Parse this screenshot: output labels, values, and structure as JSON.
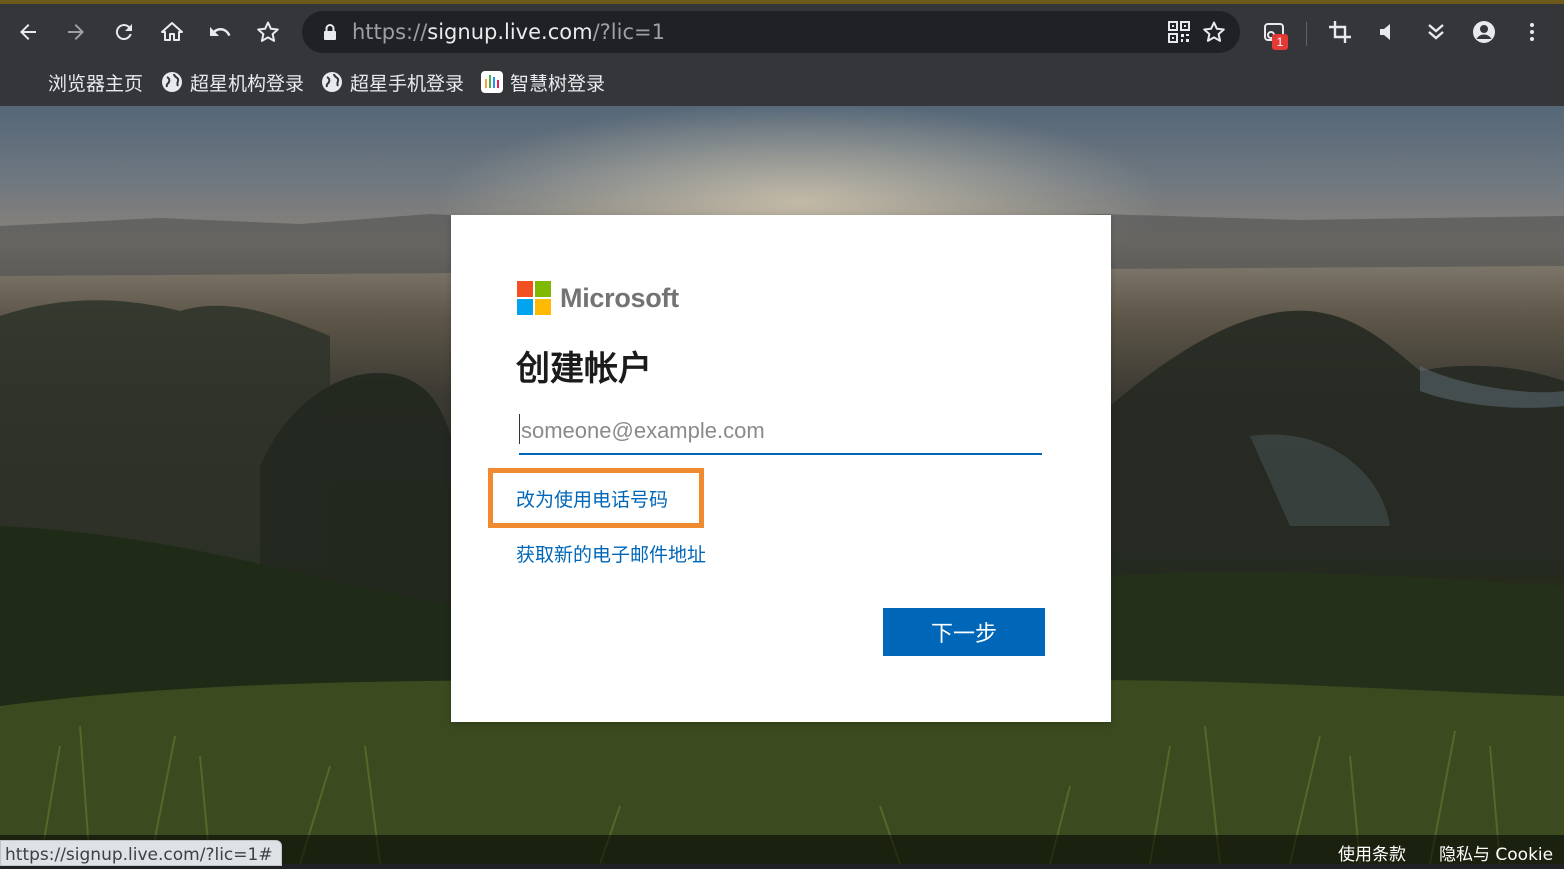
{
  "browser": {
    "url_prefix": "https://",
    "url_host": "signup.live.com",
    "url_path": "/?lic=1",
    "extension_badge": "1",
    "status_url": "https://signup.live.com/?lic=1#"
  },
  "bookmarks": [
    {
      "label": "浏览器主页",
      "icon": "none"
    },
    {
      "label": "超星机构登录",
      "icon": "globe-icon"
    },
    {
      "label": "超星手机登录",
      "icon": "globe-icon"
    },
    {
      "label": "智慧树登录",
      "icon": "zhihuishu-icon"
    }
  ],
  "card": {
    "brand": "Microsoft",
    "logo_colors": [
      "#f25022",
      "#7fba00",
      "#00a4ef",
      "#ffb900"
    ],
    "title": "创建帐户",
    "email_placeholder": "someone@example.com",
    "phone_link": "改为使用电话号码",
    "new_email_link": "获取新的电子邮件地址",
    "next_button": "下一步",
    "highlight_color": "#f08a30"
  },
  "footer": {
    "terms": "使用条款",
    "privacy": "隐私与 Cookie"
  }
}
